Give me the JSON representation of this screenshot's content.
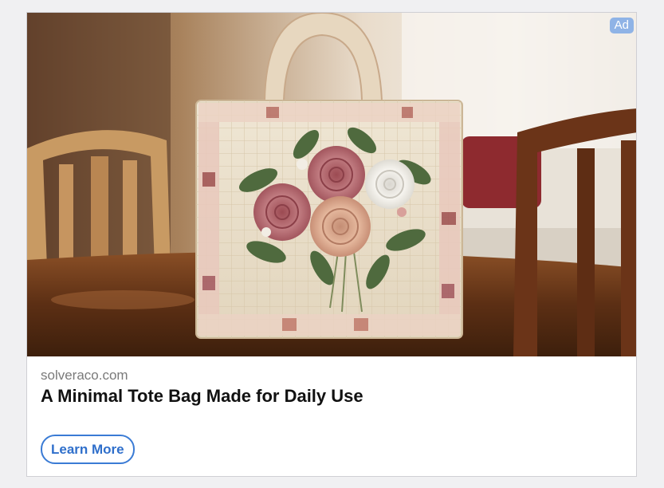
{
  "ad": {
    "badge": "Ad",
    "domain": "solveraco.com",
    "headline": "A Minimal Tote Bag Made for Daily Use",
    "cta_label": "Learn More",
    "image_subject": "quilted tote bag with embroidered rose bouquet on wooden table",
    "colors": {
      "badge_bg": "#8fb3e6",
      "cta_accent": "#3a7bd5",
      "domain_text": "#7a7a7a",
      "headline_text": "#111111"
    }
  }
}
